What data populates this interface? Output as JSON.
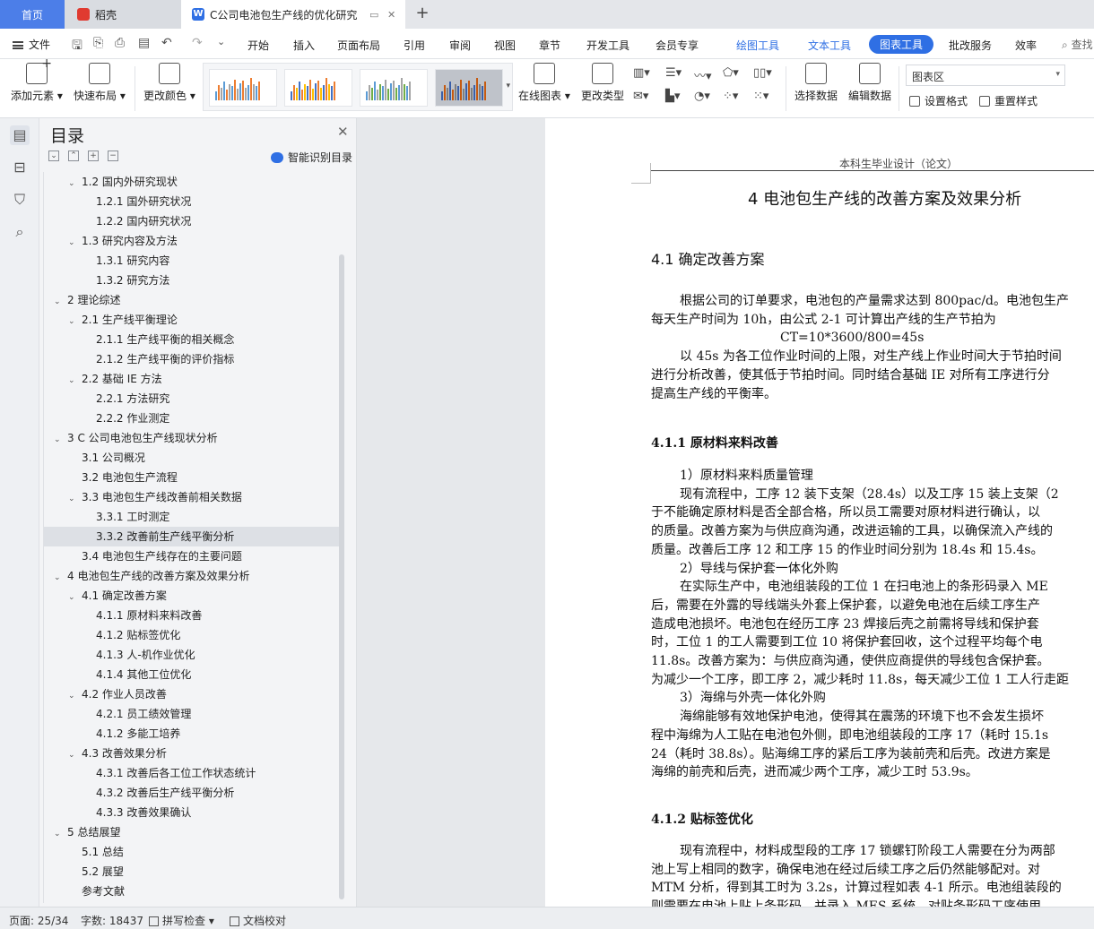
{
  "tabs": {
    "home": "首页",
    "daoke": "稻壳",
    "doc": "C公司电池包生产线的优化研究"
  },
  "menu": {
    "file": "文件",
    "items": [
      "开始",
      "插入",
      "页面布局",
      "引用",
      "审阅",
      "视图",
      "章节",
      "开发工具",
      "会员专享"
    ],
    "context": [
      "绘图工具",
      "文本工具",
      "图表工具"
    ],
    "tail": [
      "批改服务",
      "效率"
    ],
    "search": "查找"
  },
  "ribbon": {
    "add_element": "添加元素",
    "quick_layout": "快速布局",
    "change_color": "更改颜色",
    "online_chart": "在线图表",
    "change_type": "更改类型",
    "select_data": "选择数据",
    "edit_data": "编辑数据",
    "chart_area": "图表区",
    "set_format": "设置格式",
    "reset_style": "重置样式"
  },
  "toc": {
    "title": "目录",
    "smart": "智能识别目录",
    "items": [
      {
        "text": "1.2 国内外研究现状",
        "level": 2,
        "chev": true
      },
      {
        "text": "1.2.1 国外研究状况",
        "level": 3
      },
      {
        "text": "1.2.2 国内研究状况",
        "level": 3
      },
      {
        "text": "1.3 研究内容及方法",
        "level": 2,
        "chev": true
      },
      {
        "text": "1.3.1 研究内容",
        "level": 3
      },
      {
        "text": "1.3.2 研究方法",
        "level": 3
      },
      {
        "text": "2 理论综述",
        "level": 1,
        "chev": true
      },
      {
        "text": "2.1 生产线平衡理论",
        "level": 2,
        "chev": true
      },
      {
        "text": "2.1.1 生产线平衡的相关概念",
        "level": 3
      },
      {
        "text": "2.1.2 生产线平衡的评价指标",
        "level": 3
      },
      {
        "text": "2.2 基础 IE 方法",
        "level": 2,
        "chev": true
      },
      {
        "text": "2.2.1 方法研究",
        "level": 3
      },
      {
        "text": "2.2.2 作业测定",
        "level": 3
      },
      {
        "text": "3 C 公司电池包生产线现状分析",
        "level": 1,
        "chev": true
      },
      {
        "text": "3.1 公司概况",
        "level": 2
      },
      {
        "text": "3.2 电池包生产流程",
        "level": 2
      },
      {
        "text": "3.3 电池包生产线改善前相关数据",
        "level": 2,
        "chev": true
      },
      {
        "text": "3.3.1 工时测定",
        "level": 3
      },
      {
        "text": "3.3.2 改善前生产线平衡分析",
        "level": 3,
        "selected": true
      },
      {
        "text": "3.4 电池包生产线存在的主要问题",
        "level": 2
      },
      {
        "text": "4 电池包生产线的改善方案及效果分析",
        "level": 1,
        "chev": true
      },
      {
        "text": "4.1 确定改善方案",
        "level": 2,
        "chev": true
      },
      {
        "text": "4.1.1 原材料来料改善",
        "level": 3
      },
      {
        "text": "4.1.2 贴标签优化",
        "level": 3
      },
      {
        "text": "4.1.3 人-机作业优化",
        "level": 3
      },
      {
        "text": "4.1.4 其他工位优化",
        "level": 3
      },
      {
        "text": "4.2 作业人员改善",
        "level": 2,
        "chev": true
      },
      {
        "text": "4.2.1 员工绩效管理",
        "level": 3
      },
      {
        "text": "4.1.2 多能工培养",
        "level": 3
      },
      {
        "text": "4.3 改善效果分析",
        "level": 2,
        "chev": true
      },
      {
        "text": "4.3.1 改善后各工位工作状态统计",
        "level": 3
      },
      {
        "text": "4.3.2 改善后生产线平衡分析",
        "level": 3
      },
      {
        "text": "4.3.3 改善效果确认",
        "level": 3
      },
      {
        "text": "5 总结展望",
        "level": 1,
        "chev": true
      },
      {
        "text": "5.1 总结",
        "level": 2
      },
      {
        "text": "5.2 展望",
        "level": 2
      },
      {
        "text": "参考文献",
        "level": 2
      }
    ]
  },
  "doc": {
    "header": "本科生毕业设计（论文）",
    "chapter_title": "4  电池包生产线的改善方案及效果分析",
    "s41": "4.1 确定改善方案",
    "p1": [
      "根据公司的订单要求，电池包的产量需求达到 800pac/d。电池包生产",
      "每天生产时间为 10h，由公式 2-1 可计算出产线的生产节拍为",
      "CT=10*3600/800=45s",
      "以 45s 为各工位作业时间的上限，对生产线上作业时间大于节拍时间",
      "进行分析改善，使其低于节拍时间。同时结合基础 IE 对所有工序进行分",
      "提高生产线的平衡率。"
    ],
    "s411": "4.1.1 原材料来料改善",
    "p2": [
      "1）原材料来料质量管理",
      "现有流程中，工序 12 装下支架（28.4s）以及工序 15 装上支架（2",
      "于不能确定原材料是否全部合格，所以员工需要对原材料进行确认，以",
      "的质量。改善方案为与供应商沟通，改进运输的工具，以确保流入产线的",
      "质量。改善后工序 12 和工序 15 的作业时间分别为 18.4s 和 15.4s。",
      "2）导线与保护套一体化外购",
      "在实际生产中，电池组装段的工位 1 在扫电池上的条形码录入 ME",
      "后，需要在外露的导线端头外套上保护套，以避免电池在后续工序生产",
      "造成电池损坏。电池包在经历工序 23 焊接后壳之前需将导线和保护套",
      "时，工位 1 的工人需要到工位 10 将保护套回收，这个过程平均每个电",
      "11.8s。改善方案为：与供应商沟通，使供应商提供的导线包含保护套。",
      "为减少一个工序，即工序 2，减少耗时 11.8s，每天减少工位 1 工人行走距",
      "3）海绵与外壳一体化外购",
      "海绵能够有效地保护电池，使得其在震荡的环境下也不会发生损坏",
      "程中海绵为人工贴在电池包外侧，即电池组装段的工序 17（耗时 15.1s",
      "24（耗时 38.8s）。贴海绵工序的紧后工序为装前壳和后壳。改进方案是",
      "海绵的前壳和后壳，进而减少两个工序，减少工时 53.9s。"
    ],
    "s412": "4.1.2 贴标签优化",
    "p3": [
      "现有流程中，材料成型段的工序 17 锁螺钉阶段工人需要在分为两部",
      "池上写上相同的数字，确保电池在经过后续工序之后仍然能够配对。对",
      "MTM 分析，得到其工时为 3.2s，计算过程如表 4-1 所示。电池组装段的",
      "则需要在电池上贴上条形码，并录入 MES 系统，对贴条形码工序使用"
    ]
  },
  "status": {
    "page": "页面: 25/34",
    "words": "字数: 18437",
    "spell": "拼写检查",
    "proof": "文档校对"
  }
}
